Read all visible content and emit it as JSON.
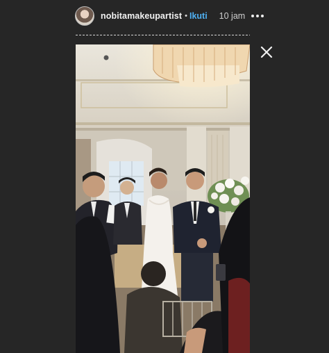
{
  "header": {
    "username": "nobitamakeupartist",
    "separator": "•",
    "follow_label": "Ikuti",
    "timestamp": "10 jam"
  },
  "icons": {
    "avatar": "profile-avatar",
    "more": "more-options-icon",
    "close": "close-icon"
  },
  "colors": {
    "background": "#262626",
    "follow": "#4fb1f3"
  }
}
